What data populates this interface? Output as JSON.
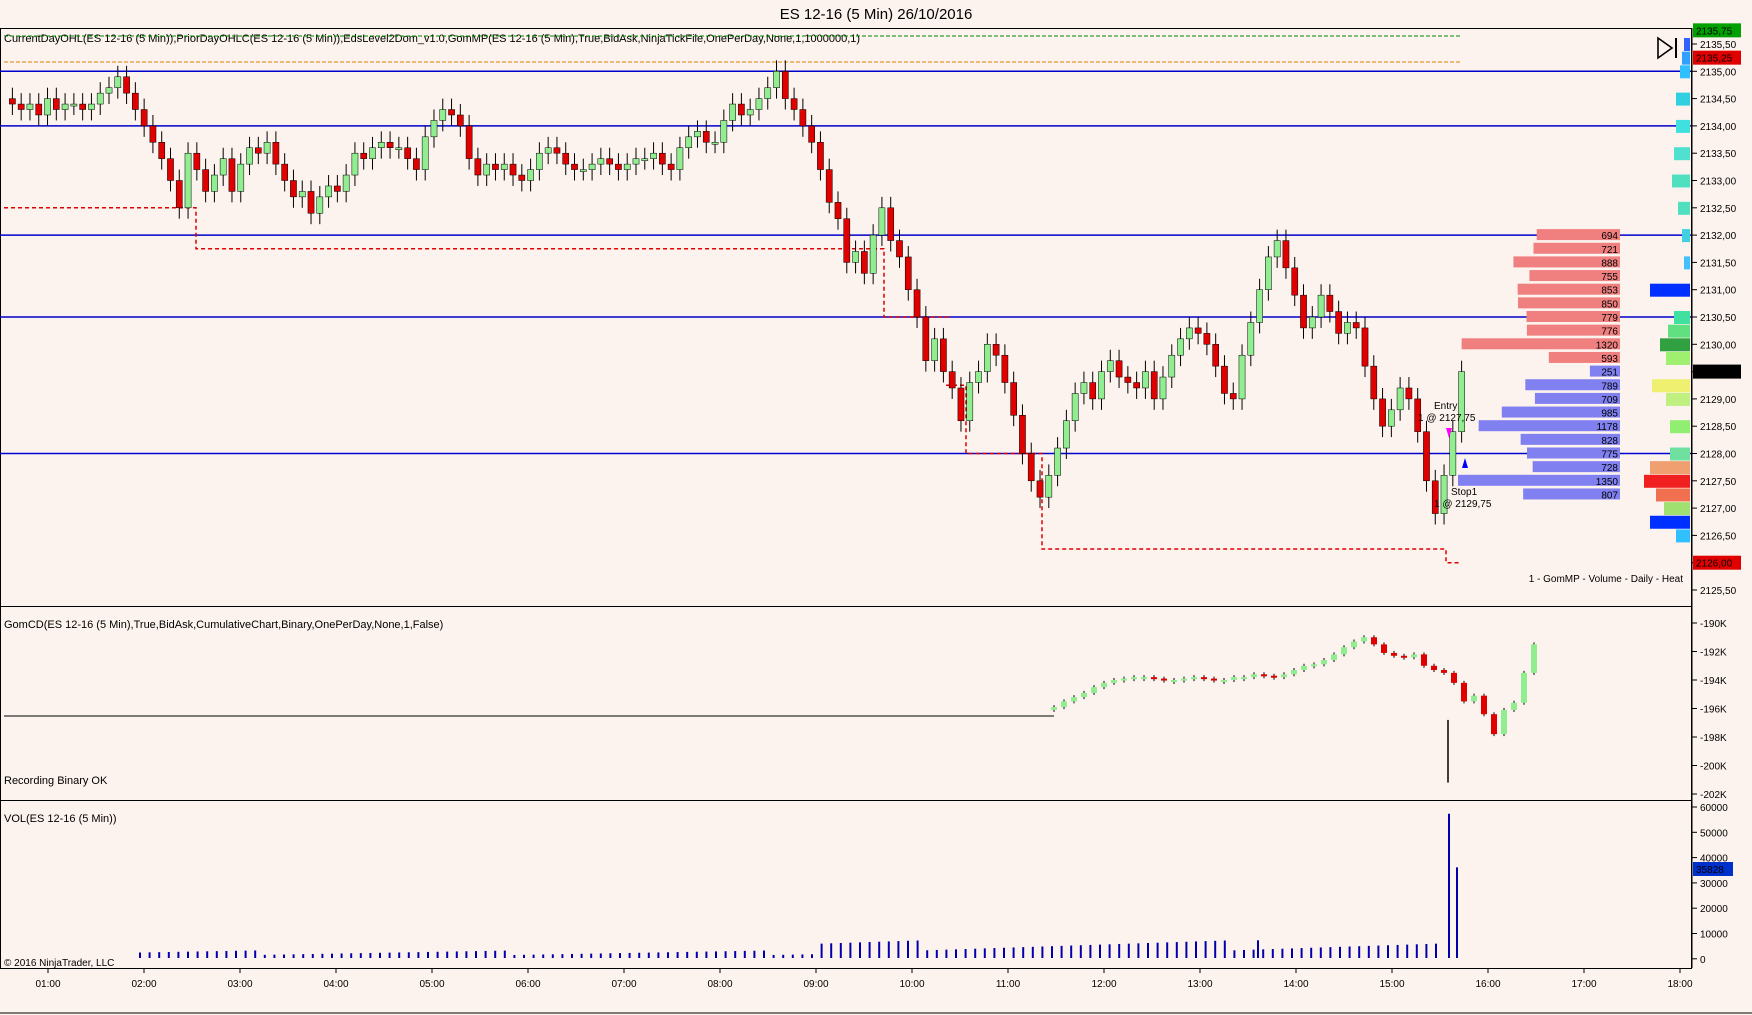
{
  "window": {
    "title": "ES 12-16 (5 Min)  26/10/2016"
  },
  "panels": {
    "price": {
      "indicator_label": "CurrentDayOHL(ES 12-16 (5 Min)),PriorDayOHLC(ES 12-16 (5 Min)),EdsLevel2Dom_v1.0,GomMP(ES 12-16 (5 Min),True,BidAsk,NinjaTickFile,OnePerDay,None,1,1000000,1)",
      "profile_label": "1 - GomMP - Volume - Daily - Heat",
      "axis_ticks": [
        "2135,50",
        "2135,00",
        "2134,50",
        "2134,00",
        "2133,50",
        "2133,00",
        "2132,50",
        "2132,00",
        "2131,50",
        "2131,00",
        "2130,50",
        "2130,00",
        "2129,50",
        "2129,00",
        "2128,50",
        "2128,00",
        "2127,50",
        "2127,00",
        "2126,50",
        "2126,00",
        "2125,50"
      ],
      "markers": {
        "high": "2135,75",
        "prior_high": "2135,25",
        "last": "2129,50",
        "low": "2126,00"
      },
      "marker_colors": {
        "high": "#00a000",
        "prior_high": "#e00000",
        "last": "#000000",
        "low": "#e00000"
      },
      "horizontal_levels": [
        2135.0,
        2134.0,
        2132.0,
        2130.5,
        2128.0
      ],
      "ask_dom": [
        {
          "price": 2132.0,
          "size": "694"
        },
        {
          "price": 2131.75,
          "size": "721"
        },
        {
          "price": 2131.5,
          "size": "888"
        },
        {
          "price": 2131.25,
          "size": "755"
        },
        {
          "price": 2131.0,
          "size": "853"
        },
        {
          "price": 2130.75,
          "size": "850"
        },
        {
          "price": 2130.5,
          "size": "779"
        },
        {
          "price": 2130.25,
          "size": "776"
        },
        {
          "price": 2130.0,
          "size": "1320"
        },
        {
          "price": 2129.75,
          "size": "593"
        }
      ],
      "bid_dom": [
        {
          "price": 2129.5,
          "size": "251"
        },
        {
          "price": 2129.25,
          "size": "789"
        },
        {
          "price": 2129.0,
          "size": "709"
        },
        {
          "price": 2128.75,
          "size": "985"
        },
        {
          "price": 2128.5,
          "size": "1178"
        },
        {
          "price": 2128.25,
          "size": "828"
        },
        {
          "price": 2128.0,
          "size": "775"
        },
        {
          "price": 2127.75,
          "size": "728"
        },
        {
          "price": 2127.5,
          "size": "1350"
        },
        {
          "price": 2127.25,
          "size": "807"
        }
      ],
      "orders": {
        "entry_label": "Entry",
        "entry_detail": "1 @ 2127,75",
        "stop_label": "Stop1",
        "stop_detail": "1 @ 2129,75"
      }
    },
    "cumulative_delta": {
      "indicator_label": "GomCD(ES 12-16 (5 Min),True,BidAsk,CumulativeChart,Binary,OnePerDay,None,1,False)",
      "status": "Recording Binary OK",
      "axis_ticks": [
        "-190K",
        "-192K",
        "-194K",
        "-196K",
        "-198K",
        "-200K",
        "-202K"
      ]
    },
    "volume": {
      "indicator_label": "VOL(ES 12-16 (5 Min))",
      "axis_ticks": [
        "60000",
        "50000",
        "40000",
        "30000",
        "20000",
        "10000",
        "0"
      ],
      "last_marker": "35828",
      "copyright": "© 2016 NinjaTrader, LLC"
    }
  },
  "time_axis": [
    "01:00",
    "02:00",
    "03:00",
    "04:00",
    "05:00",
    "06:00",
    "07:00",
    "08:00",
    "09:00",
    "10:00",
    "11:00",
    "12:00",
    "13:00",
    "14:00",
    "15:00",
    "16:00",
    "17:00",
    "18:00"
  ],
  "colors": {
    "background": "#fdf3ee",
    "up_candle": "#90ee90",
    "down_candle": "#e00000",
    "level_line": "#0000cc",
    "prior_low": "#e00000",
    "volume_bar": "#0000aa",
    "ask_bar": "#f08080",
    "bid_bar": "#8080f0"
  },
  "icons": {
    "play_pause": "play-pause-icon"
  }
}
